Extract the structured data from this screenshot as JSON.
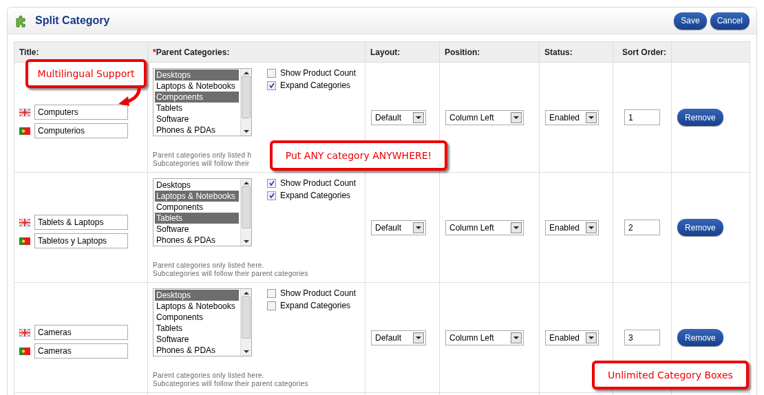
{
  "header": {
    "title": "Split Category",
    "buttons": [
      "Save",
      "Cancel"
    ]
  },
  "table": {
    "columns": [
      {
        "label": "Title:"
      },
      {
        "label": "Parent Categories:",
        "required_mark": "*"
      },
      {
        "label": "Layout:"
      },
      {
        "label": "Position:"
      },
      {
        "label": "Status:"
      },
      {
        "label": "Sort Order:"
      }
    ],
    "rows": [
      {
        "titles": [
          {
            "kind": "uk",
            "value": "Computers"
          },
          {
            "kind": "pt",
            "value": "Computerios"
          }
        ],
        "categories": [
          {
            "label": "Desktops",
            "selected": true
          },
          {
            "label": "Laptops & Notebooks",
            "selected": false
          },
          {
            "label": "Components",
            "selected": true
          },
          {
            "label": "Tablets",
            "selected": false
          },
          {
            "label": "Software",
            "selected": false
          },
          {
            "label": "Phones & PDAs",
            "selected": false
          }
        ],
        "options": [
          {
            "label": "Show Product Count",
            "checked": false
          },
          {
            "label": "Expand Categories",
            "checked": true
          }
        ],
        "hint": [
          "Parent categories only listed h",
          "Subcategories will follow their"
        ],
        "layout": "Default",
        "position": "Column Left",
        "status": "Enabled",
        "sort_order": "1",
        "action": "Remove"
      },
      {
        "titles": [
          {
            "kind": "uk",
            "value": "Tablets & Laptops"
          },
          {
            "kind": "pt",
            "value": "Tabletos y Laptops"
          }
        ],
        "categories": [
          {
            "label": "Desktops",
            "selected": false
          },
          {
            "label": "Laptops & Notebooks",
            "selected": true
          },
          {
            "label": "Components",
            "selected": false
          },
          {
            "label": "Tablets",
            "selected": true
          },
          {
            "label": "Software",
            "selected": false
          },
          {
            "label": "Phones & PDAs",
            "selected": false
          }
        ],
        "options": [
          {
            "label": "Show Product Count",
            "checked": true
          },
          {
            "label": "Expand Categories",
            "checked": true
          }
        ],
        "hint": [
          "Parent categories only listed here.",
          "Subcategories will follow their parent categories"
        ],
        "layout": "Default",
        "position": "Column Left",
        "status": "Enabled",
        "sort_order": "2",
        "action": "Remove"
      },
      {
        "titles": [
          {
            "kind": "uk",
            "value": "Cameras"
          },
          {
            "kind": "pt",
            "value": "Cameras"
          }
        ],
        "categories": [
          {
            "label": "Desktops",
            "selected": true
          },
          {
            "label": "Laptops & Notebooks",
            "selected": false
          },
          {
            "label": "Components",
            "selected": false
          },
          {
            "label": "Tablets",
            "selected": false
          },
          {
            "label": "Software",
            "selected": false
          },
          {
            "label": "Phones & PDAs",
            "selected": false
          }
        ],
        "options": [
          {
            "label": "Show Product Count",
            "checked": false
          },
          {
            "label": "Expand Categories",
            "checked": false
          }
        ],
        "hint": [
          "Parent categories only listed here.",
          "Subcategories will follow their parent categories"
        ],
        "layout": "Default",
        "position": "Column Left",
        "status": "Enabled",
        "sort_order": "3",
        "action": "Remove"
      }
    ]
  },
  "callouts": [
    {
      "kind": "arrow",
      "text": "Multilingual Support"
    },
    {
      "kind": "plain",
      "text": "Put ANY category ANYWHERE!"
    },
    {
      "kind": "plain",
      "text": "Unlimited Category Boxes"
    }
  ]
}
